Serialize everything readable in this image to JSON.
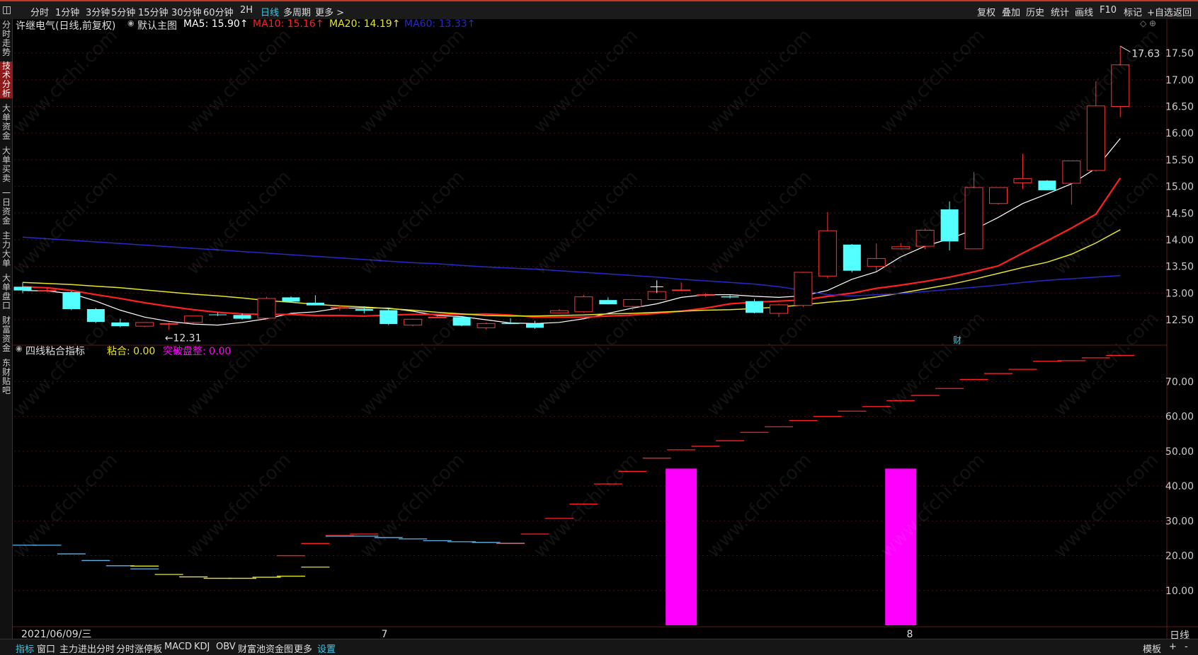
{
  "topbar": {
    "periods": [
      "分时",
      "1分钟",
      "3分钟",
      "5分钟",
      "15分钟",
      "30分钟",
      "60分钟",
      "2H",
      "日线",
      "多周期",
      "更多 >"
    ],
    "active_period": "日线",
    "right_tools": [
      "复权",
      "叠加",
      "历史",
      "统计",
      "画线",
      "F10",
      "标记",
      "+自选",
      "返回"
    ]
  },
  "sidebar": {
    "items": [
      "分时走势",
      "技术分析",
      "大单资金",
      "大单买卖",
      "一日资金",
      "主力大单",
      "大单盘口",
      "财富资金",
      "东财贴吧"
    ],
    "active": "技术分析"
  },
  "main_legend": {
    "stock": "许继电气(日线,前复权)",
    "chart_name": "默认主图",
    "ma5": "MA5: 15.90↑",
    "ma10": "MA10: 15.16↑",
    "ma20": "MA20: 14.19↑",
    "ma60": "MA60: 13.33↑"
  },
  "sub_legend": {
    "name": "四线粘合指标",
    "nianhe": "粘合: 0.00",
    "tupo": "突破盘整: 0.00"
  },
  "annotations": {
    "high": "17.63",
    "low": "←12.31",
    "cai": "财"
  },
  "xaxis": {
    "start": "2021/06/09/三",
    "m7": "7",
    "m8": "8",
    "right": "日线"
  },
  "bottombar": {
    "items": [
      "指标",
      "窗口",
      "主力进出分时",
      "分时涨停板",
      "MACD",
      "KDJ",
      "OBV",
      "财富池资金图",
      "更多",
      "设置"
    ],
    "active": [
      "指标",
      "设置"
    ],
    "right": [
      "模板",
      "+",
      "-"
    ]
  },
  "watermark": "www.cfchi.com",
  "colors": {
    "up": "#ff3333",
    "down": "#54ffff",
    "ma5": "#ffffff",
    "ma10": "#ff2020",
    "ma20": "#e5e52a",
    "ma60": "#2828c8",
    "magenta": "#ff00ff"
  },
  "chart_data": [
    {
      "type": "candlestick",
      "title": "许继电气(日线,前复权)",
      "ylim": [
        12.05,
        17.9
      ],
      "yticks": [
        12.5,
        13.0,
        13.5,
        14.0,
        14.5,
        15.0,
        15.5,
        16.0,
        16.5,
        17.0,
        17.5
      ],
      "ohlc": [
        [
          13.12,
          13.2,
          13.0,
          13.05
        ],
        [
          13.05,
          13.1,
          13.02,
          13.05
        ],
        [
          13.02,
          13.04,
          12.68,
          12.7
        ],
        [
          12.7,
          12.72,
          12.44,
          12.46
        ],
        [
          12.45,
          12.52,
          12.36,
          12.38
        ],
        [
          12.38,
          12.45,
          12.36,
          12.45
        ],
        [
          12.42,
          12.45,
          12.31,
          12.43
        ],
        [
          12.45,
          12.58,
          12.43,
          12.57
        ],
        [
          12.6,
          12.64,
          12.57,
          12.59
        ],
        [
          12.59,
          12.62,
          12.5,
          12.52
        ],
        [
          12.53,
          12.93,
          12.52,
          12.9
        ],
        [
          12.92,
          12.94,
          12.83,
          12.84
        ],
        [
          12.82,
          12.96,
          12.77,
          12.77
        ],
        [
          12.73,
          12.78,
          12.67,
          12.73
        ],
        [
          12.7,
          12.75,
          12.62,
          12.67
        ],
        [
          12.68,
          12.72,
          12.4,
          12.42
        ],
        [
          12.4,
          12.52,
          12.38,
          12.51
        ],
        [
          12.55,
          12.57,
          12.53,
          12.55
        ],
        [
          12.55,
          12.56,
          12.38,
          12.39
        ],
        [
          12.35,
          12.45,
          12.32,
          12.43
        ],
        [
          12.44,
          12.53,
          12.42,
          12.42
        ],
        [
          12.43,
          12.48,
          12.33,
          12.35
        ],
        [
          12.63,
          12.7,
          12.62,
          12.67
        ],
        [
          12.65,
          12.97,
          12.63,
          12.93
        ],
        [
          12.87,
          12.92,
          12.79,
          12.79
        ],
        [
          12.75,
          12.89,
          12.68,
          12.88
        ],
        [
          12.88,
          13.05,
          12.87,
          13.03
        ],
        [
          13.06,
          13.2,
          13.04,
          13.06
        ],
        [
          12.97,
          13.0,
          12.93,
          12.97
        ],
        [
          12.94,
          12.96,
          12.9,
          12.92
        ],
        [
          12.85,
          12.89,
          12.62,
          12.63
        ],
        [
          12.62,
          12.8,
          12.55,
          12.78
        ],
        [
          12.77,
          13.4,
          12.74,
          13.39
        ],
        [
          13.32,
          14.52,
          13.28,
          14.17
        ],
        [
          13.91,
          13.92,
          13.39,
          13.42
        ],
        [
          13.5,
          13.93,
          13.41,
          13.65
        ],
        [
          13.83,
          13.94,
          13.83,
          13.87
        ],
        [
          13.88,
          14.21,
          13.82,
          14.18
        ],
        [
          14.57,
          14.72,
          13.8,
          13.97
        ],
        [
          13.83,
          15.27,
          13.83,
          14.98
        ],
        [
          14.68,
          14.98,
          14.66,
          14.98
        ],
        [
          15.07,
          15.61,
          14.95,
          15.15
        ],
        [
          15.11,
          15.12,
          14.93,
          14.93
        ],
        [
          15.06,
          15.42,
          14.66,
          15.48
        ],
        [
          15.3,
          16.97,
          15.28,
          16.51
        ],
        [
          16.5,
          17.63,
          16.3,
          17.28
        ]
      ],
      "ma": {
        "MA5": [
          13.05,
          13.04,
          12.99,
          12.85,
          12.68,
          12.55,
          12.47,
          12.42,
          12.4,
          12.45,
          12.52,
          12.62,
          12.65,
          12.72,
          12.72,
          12.72,
          12.66,
          12.58,
          12.56,
          12.5,
          12.44,
          12.43,
          12.45,
          12.52,
          12.62,
          12.72,
          12.8,
          12.92,
          12.97,
          12.97,
          12.94,
          12.92,
          12.95,
          13.05,
          13.26,
          13.4,
          13.68,
          13.88,
          14.02,
          14.19,
          14.42,
          14.68,
          14.86,
          15.05,
          15.34,
          15.9
        ],
        "MA10": [
          13.12,
          13.1,
          13.05,
          12.97,
          12.9,
          12.82,
          12.75,
          12.69,
          12.64,
          12.61,
          12.6,
          12.6,
          12.58,
          12.58,
          12.57,
          12.59,
          12.6,
          12.6,
          12.6,
          12.61,
          12.59,
          12.55,
          12.55,
          12.55,
          12.57,
          12.59,
          12.62,
          12.66,
          12.72,
          12.8,
          12.83,
          12.85,
          12.87,
          12.94,
          13.0,
          13.09,
          13.15,
          13.22,
          13.3,
          13.4,
          13.51,
          13.75,
          13.98,
          14.22,
          14.48,
          15.16
        ],
        "MA20": [
          13.2,
          13.18,
          13.16,
          13.13,
          13.1,
          13.06,
          13.02,
          12.98,
          12.95,
          12.91,
          12.86,
          12.83,
          12.79,
          12.76,
          12.74,
          12.71,
          12.68,
          12.64,
          12.61,
          12.58,
          12.57,
          12.57,
          12.58,
          12.59,
          12.61,
          12.62,
          12.64,
          12.66,
          12.68,
          12.69,
          12.71,
          12.74,
          12.78,
          12.83,
          12.87,
          12.93,
          13.0,
          13.08,
          13.16,
          13.26,
          13.37,
          13.48,
          13.58,
          13.73,
          13.94,
          14.19
        ],
        "MA60": [
          14.05,
          14.02,
          13.99,
          13.96,
          13.93,
          13.9,
          13.87,
          13.84,
          13.81,
          13.78,
          13.75,
          13.72,
          13.69,
          13.66,
          13.63,
          13.6,
          13.57,
          13.55,
          13.52,
          13.49,
          13.47,
          13.45,
          13.42,
          13.39,
          13.36,
          13.33,
          13.3,
          13.26,
          13.23,
          13.2,
          13.17,
          13.12,
          13.05,
          12.97,
          12.95,
          12.97,
          12.99,
          13.03,
          13.07,
          13.11,
          13.15,
          13.2,
          13.24,
          13.27,
          13.3,
          13.33
        ]
      }
    },
    {
      "type": "bar",
      "title": "四线粘合指标",
      "ylim": [
        0,
        78
      ],
      "yticks": [
        10,
        20,
        30,
        40,
        50,
        60,
        70
      ],
      "bars": [
        {
          "index": 27,
          "value": 45
        },
        {
          "index": 36,
          "value": 45
        }
      ],
      "series": [
        {
          "name": "MA60",
          "color": "#5fb4e6",
          "values": [
            23.0,
            23.0,
            20.5,
            18.6,
            17.1,
            16.2,
            null,
            null,
            null,
            null,
            null,
            null,
            null,
            25.6,
            25.6,
            25.2,
            24.8,
            24.3,
            24.0,
            23.8,
            23.5,
            null,
            null,
            null,
            null,
            null,
            null,
            null,
            null,
            null,
            null,
            null,
            null,
            null,
            null,
            null,
            null,
            null,
            null,
            null,
            null,
            null,
            null,
            null,
            null,
            null
          ]
        },
        {
          "name": "MA20",
          "color": "#e5e52a",
          "values": [
            null,
            null,
            null,
            null,
            null,
            17.0,
            14.6,
            13.9,
            13.5,
            13.5,
            13.8,
            14.1,
            16.7,
            null,
            null,
            null,
            null,
            null,
            null,
            null,
            null,
            null,
            null,
            null,
            null,
            null,
            null,
            null,
            null,
            null,
            null,
            null,
            null,
            null,
            null,
            null,
            null,
            null,
            null,
            null,
            null,
            null,
            null,
            null,
            null,
            null
          ]
        },
        {
          "name": "MA10",
          "color": "#ff2020",
          "values": [
            null,
            null,
            null,
            null,
            null,
            null,
            null,
            null,
            null,
            null,
            null,
            20.0,
            23.5,
            25.8,
            26.2,
            null,
            null,
            null,
            null,
            null,
            23.6,
            26.2,
            30.7,
            34.8,
            40.6,
            44.2,
            48.0,
            50.4,
            51.4,
            53.0,
            55.4,
            57.0,
            58.8,
            60.0,
            61.5,
            62.8,
            64.5,
            66.0,
            68.0,
            70.6,
            72.3,
            73.5,
            75.8,
            76.0,
            76.8,
            77.5
          ]
        }
      ]
    }
  ]
}
